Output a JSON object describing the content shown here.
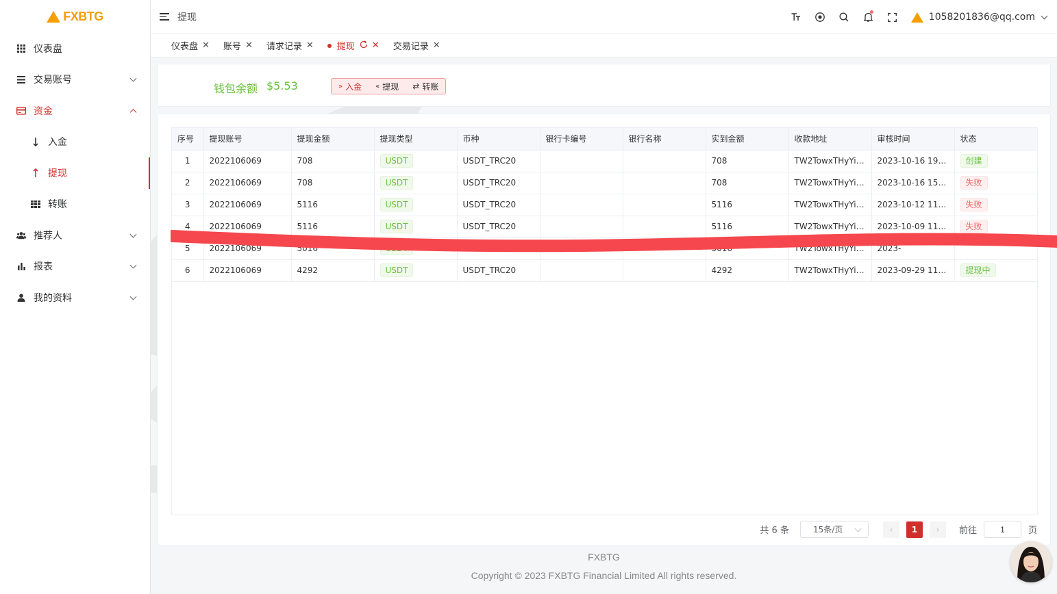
{
  "brand": {
    "logo_text": "FXBTG"
  },
  "colors": {
    "accent": "#d0302c",
    "logo": "#f5a000",
    "success": "#67c23a",
    "danger": "#f56c6c"
  },
  "sidebar": {
    "items": [
      {
        "label": "仪表盘",
        "icon": "grid-icon"
      },
      {
        "label": "交易账号",
        "icon": "list-icon"
      },
      {
        "label": "资金",
        "icon": "card-icon"
      },
      {
        "label": "入金",
        "icon": "arrow-down-icon"
      },
      {
        "label": "提现",
        "icon": "arrow-up-icon"
      },
      {
        "label": "转账",
        "icon": "grid-icon"
      },
      {
        "label": "推荐人",
        "icon": "users-icon"
      },
      {
        "label": "报表",
        "icon": "bar-chart-icon"
      },
      {
        "label": "我的资料",
        "icon": "user-icon"
      }
    ]
  },
  "header": {
    "breadcrumb": "提现",
    "user_email": "1058201836@qq.com",
    "font_size_icon_text": "T"
  },
  "tags": [
    {
      "label": "仪表盘"
    },
    {
      "label": "账号"
    },
    {
      "label": "请求记录"
    },
    {
      "label": "提现"
    },
    {
      "label": "交易记录"
    }
  ],
  "wallet": {
    "label": "钱包余额",
    "value": "$5.53",
    "deposit_label": "入金",
    "withdraw_label": "提现",
    "transfer_label": "转账"
  },
  "table": {
    "headers": [
      "序号",
      "提现账号",
      "提现金额",
      "提现类型",
      "币种",
      "银行卡编号",
      "银行名称",
      "实到金额",
      "收款地址",
      "审核时间",
      "状态"
    ],
    "rows": [
      {
        "no": "1",
        "account": "2022106069",
        "amount": "708",
        "type": "USDT",
        "currency": "USDT_TRC20",
        "card": "",
        "bank": "",
        "received": "708",
        "address": "TW2TowxTHyYis...",
        "time": "2023-10-16 19:0...",
        "status": "创建",
        "status_color": "green"
      },
      {
        "no": "2",
        "account": "2022106069",
        "amount": "708",
        "type": "USDT",
        "currency": "USDT_TRC20",
        "card": "",
        "bank": "",
        "received": "708",
        "address": "TW2TowxTHyYis...",
        "time": "2023-10-16 15:0...",
        "status": "失败",
        "status_color": "red"
      },
      {
        "no": "3",
        "account": "2022106069",
        "amount": "5116",
        "type": "USDT",
        "currency": "USDT_TRC20",
        "card": "",
        "bank": "",
        "received": "5116",
        "address": "TW2TowxTHyYis...",
        "time": "2023-10-12 11:4...",
        "status": "失败",
        "status_color": "red"
      },
      {
        "no": "4",
        "account": "2022106069",
        "amount": "5116",
        "type": "USDT",
        "currency": "USDT_TRC20",
        "card": "",
        "bank": "",
        "received": "5116",
        "address": "TW2TowxTHyYis...",
        "time": "2023-10-09 11:0...",
        "status": "失败",
        "status_color": "red"
      },
      {
        "no": "5",
        "account": "2022106069",
        "amount": "5016",
        "type": "USDT",
        "currency": "",
        "card": "",
        "bank": "",
        "received": "5016",
        "address": "TW2TowxTHyYis...",
        "time": "2023-",
        "status": "",
        "status_color": "green"
      },
      {
        "no": "6",
        "account": "2022106069",
        "amount": "4292",
        "type": "USDT",
        "currency": "USDT_TRC20",
        "card": "",
        "bank": "",
        "received": "4292",
        "address": "TW2TowxTHyYis...",
        "time": "2023-09-29 11:1...",
        "status": "提现中",
        "status_color": "green"
      }
    ]
  },
  "pagination": {
    "total": "共 6 条",
    "page_size": "15条/页",
    "current_page": "1",
    "goto_label": "前往",
    "goto_value": "1",
    "page_suffix": "页"
  },
  "footer": {
    "brand": "FXBTG",
    "copyright": "Copyright © 2023 FXBTG Financial Limited All rights reserved."
  }
}
